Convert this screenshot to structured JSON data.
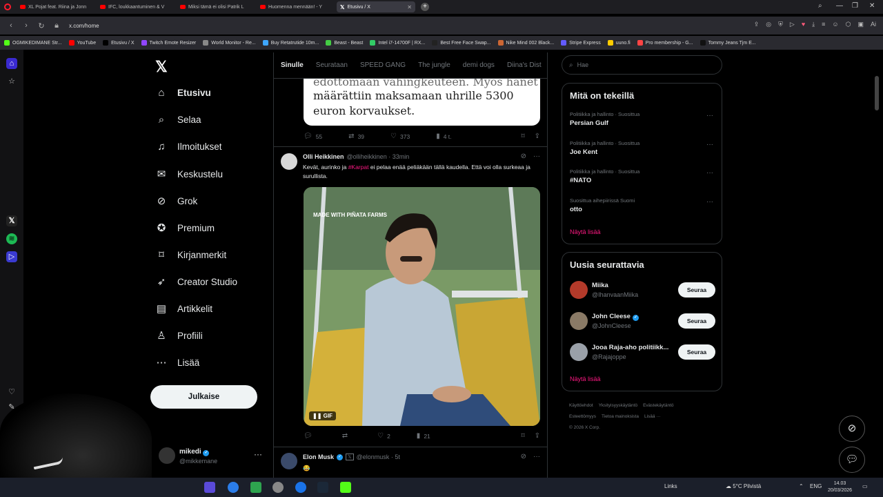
{
  "browser": {
    "tabs": [
      {
        "label": "XL Pojat feat. Riina ja Jonn"
      },
      {
        "label": "IFC, loukkaantuminen & V"
      },
      {
        "label": "Miksi tämä ei olisi Patrik L"
      },
      {
        "label": "Huomenna mennään! - Y"
      },
      {
        "label": "Etusivu / X"
      }
    ],
    "url": "x.com/home",
    "bookmarks": [
      {
        "label": "OGMIKEDIMANE Str...",
        "color": "#53fc18"
      },
      {
        "label": "YouTube",
        "color": "#ff0000"
      },
      {
        "label": "Etusivu / X",
        "color": "#000000"
      },
      {
        "label": "Twitch Emote Resizer",
        "color": "#9146ff"
      },
      {
        "label": "World Monitor - Re...",
        "color": "#888888"
      },
      {
        "label": "Buy Retatrutide 10m...",
        "color": "#3ea6ff"
      },
      {
        "label": "Beast - Beast",
        "color": "#44cc44"
      },
      {
        "label": "Intel i7-14700F | RX...",
        "color": "#33cc66"
      },
      {
        "label": "Best Free Face Swap...",
        "color": "#222222"
      },
      {
        "label": "Nike Mind 002 Black...",
        "color": "#cc6633"
      },
      {
        "label": "Stripe Express",
        "color": "#635bff"
      },
      {
        "label": "uuno.fi",
        "color": "#ffcc00"
      },
      {
        "label": "Pro membership - G...",
        "color": "#ff4444"
      },
      {
        "label": "Tommy Jeans Tjm E...",
        "color": "#111111"
      }
    ]
  },
  "nav": {
    "items": [
      {
        "label": "Etusivu",
        "icon": "home-icon"
      },
      {
        "label": "Selaa",
        "icon": "search-icon"
      },
      {
        "label": "Ilmoitukset",
        "icon": "bell-icon"
      },
      {
        "label": "Keskustelu",
        "icon": "mail-icon"
      },
      {
        "label": "Grok",
        "icon": "grok-icon"
      },
      {
        "label": "Premium",
        "icon": "premium-icon"
      },
      {
        "label": "Kirjanmerkit",
        "icon": "bookmark-icon"
      },
      {
        "label": "Creator Studio",
        "icon": "rocket-icon"
      },
      {
        "label": "Artikkelit",
        "icon": "article-icon"
      },
      {
        "label": "Profiili",
        "icon": "profile-icon"
      },
      {
        "label": "Lisää",
        "icon": "more-icon"
      }
    ],
    "post_button": "Julkaise",
    "account": {
      "name": "mikedi",
      "handle": "@mikkemane"
    }
  },
  "timeline": {
    "tabs": [
      "Sinulle",
      "Seurataan",
      "SPEED GANG",
      "The jungle",
      "demi dogs",
      "Diina's Dist"
    ],
    "prev_post": {
      "article_lines": [
        "edottomaan vahingkeuteen. Myös hänet",
        "määrättiin maksamaan uhrille 5300",
        "euron korvaukset."
      ],
      "replies": "55",
      "reposts": "39",
      "likes": "373",
      "views": "4 t."
    },
    "post1": {
      "name": "Olli Heikkinen",
      "handle": "@olliheikkinen",
      "time": "33min",
      "text_before": "Kevät, aurinko ja ",
      "hashtag": "#Karpat",
      "text_after": " ei pelaa enää peliäkään tällä kaudella. Että voi olla surkeaa ja surullista.",
      "gif_label": "GIF",
      "watermark": "MADE WITH PIÑATA FARMS",
      "replies": "",
      "reposts": "",
      "likes": "2",
      "views": "21"
    },
    "post2": {
      "name": "Elon Musk",
      "handle": "@elonmusk",
      "time": "5t",
      "text": "😂"
    }
  },
  "sidebar": {
    "search_placeholder": "Hae",
    "trends_title": "Mitä on tekeillä",
    "trends": [
      {
        "meta": "Politiikka ja hallinto · Suosittua",
        "name": "Persian Gulf"
      },
      {
        "meta": "Politiikka ja hallinto · Suosittua",
        "name": "Joe Kent"
      },
      {
        "meta": "Politiikka ja hallinto · Suosittua",
        "name": "#NATO"
      },
      {
        "meta": "Suosittua aihepiirissä Suomi",
        "name": "otto"
      }
    ],
    "trends_more": "Näytä lisää",
    "follow_title": "Uusia seurattavia",
    "follow": [
      {
        "name": "Miika",
        "handle": "@IhanvaanMiika",
        "button": "Seuraa",
        "color": "#b33a2a"
      },
      {
        "name": "John Cleese",
        "handle": "@JohnCleese",
        "button": "Seuraa",
        "color": "#8a7a66"
      },
      {
        "name": "Jooa Raja-aho politiikk...",
        "handle": "@Rajajoppe",
        "button": "Seuraa",
        "color": "#9aa0a8"
      }
    ],
    "follow_more": "Näytä lisää",
    "footer": [
      "Käyttöehdot",
      "Yksityisyyskäytäntö",
      "Evästekäytäntö",
      "Esteettömyys",
      "Tietoa mainoksista",
      "Lisää ···",
      "© 2026 X Corp."
    ]
  },
  "taskbar": {
    "links": "Links",
    "weather": "5°C Pilvistä",
    "lang": "ENG",
    "time": "14.03",
    "date": "20/03/2026"
  }
}
